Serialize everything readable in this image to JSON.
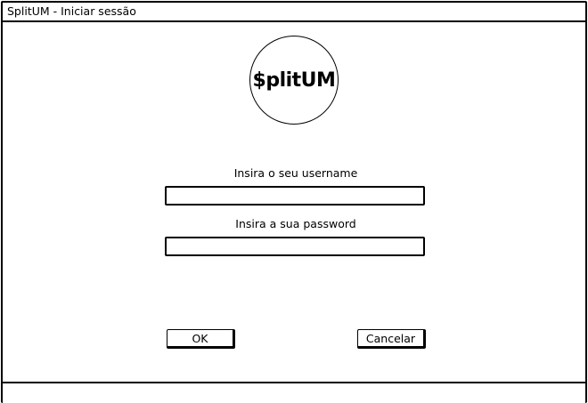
{
  "window": {
    "title": "SplitUM - Iniciar sessão"
  },
  "logo": {
    "text": "$plitUM"
  },
  "form": {
    "username_label": "Insira o seu username",
    "username_value": "",
    "password_label": "Insira a sua password",
    "password_value": ""
  },
  "buttons": {
    "ok_label": "OK",
    "cancel_label": "Cancelar"
  },
  "statusbar": {
    "text": ""
  }
}
